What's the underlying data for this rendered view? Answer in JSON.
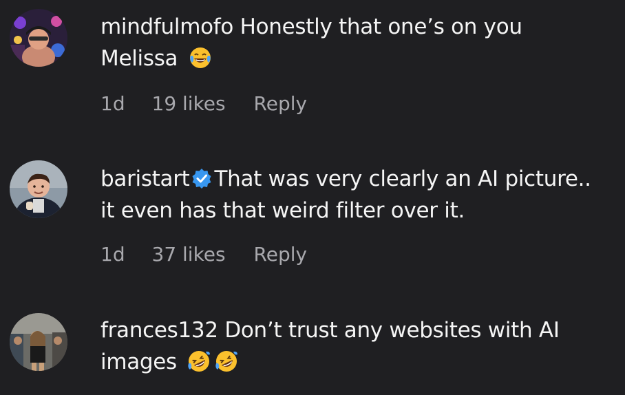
{
  "comments": [
    {
      "username": "mindfulmofo",
      "text_line1": "Honestly that one’s on you",
      "text_line2": "Melissa",
      "emoji": [
        "face-with-tears-of-joy"
      ],
      "time": "1d",
      "likes": "19 likes",
      "reply": "Reply",
      "verified": false
    },
    {
      "username": "baristart",
      "text_line1": "That was very clearly an AI picture..",
      "text_line2": "it even has that weird filter over it.",
      "emoji": [],
      "time": "1d",
      "likes": "37 likes",
      "reply": "Reply",
      "verified": true
    },
    {
      "username": "frances132",
      "text_line1": "Don’t trust any websites with AI",
      "text_line2": "images",
      "emoji": [
        "rolling-on-the-floor-laughing",
        "rolling-on-the-floor-laughing"
      ],
      "time": "",
      "likes": "",
      "reply": "",
      "verified": false
    }
  ],
  "colors": {
    "background": "#1f1f22",
    "text": "#f5f5f5",
    "meta": "#a8a8ad",
    "verified": "#3897f0"
  }
}
